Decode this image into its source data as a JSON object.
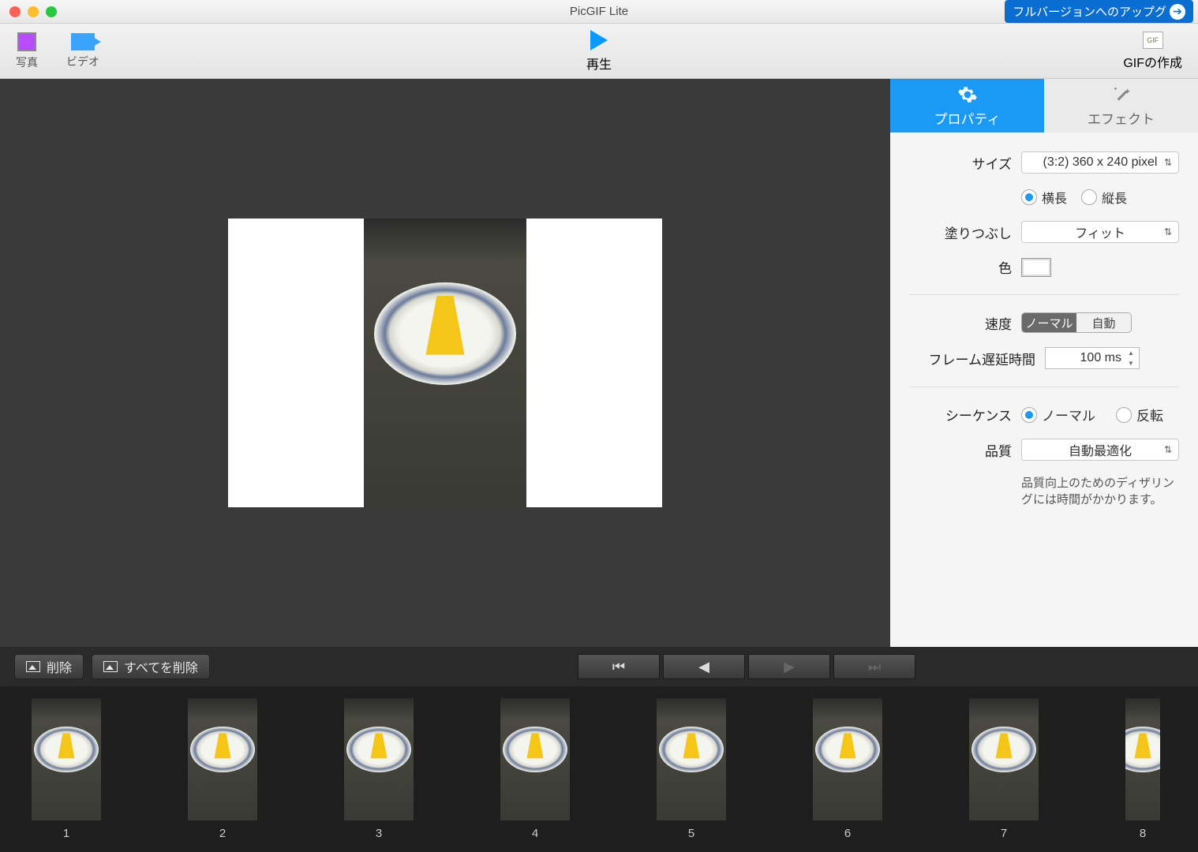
{
  "window": {
    "title": "PicGIF Lite"
  },
  "upgrade": {
    "label": "フルバージョンへのアップグ"
  },
  "toolbar": {
    "photo": "写真",
    "video": "ビデオ",
    "play": "再生",
    "gif": "GIFの作成",
    "gif_badge": "GIF"
  },
  "tabs": {
    "properties": "プロパティ",
    "effects": "エフェクト"
  },
  "props": {
    "size_label": "サイズ",
    "size_value": "(3:2) 360 x 240 pixel",
    "landscape": "横長",
    "portrait": "縦長",
    "fill_label": "塗りつぶし",
    "fill_value": "フィット",
    "color_label": "色",
    "speed_label": "速度",
    "speed_normal": "ノーマル",
    "speed_auto": "自動",
    "delay_label": "フレーム遅延時間",
    "delay_value": "100 ms",
    "sequence_label": "シーケンス",
    "seq_normal": "ノーマル",
    "seq_reverse": "反転",
    "quality_label": "品質",
    "quality_value": "自動最適化",
    "quality_hint": "品質向上のためのディザリングには時間がかかります。"
  },
  "timeline": {
    "delete": "削除",
    "delete_all": "すべてを削除"
  },
  "frames": [
    "1",
    "2",
    "3",
    "4",
    "5",
    "6",
    "7",
    "8"
  ]
}
